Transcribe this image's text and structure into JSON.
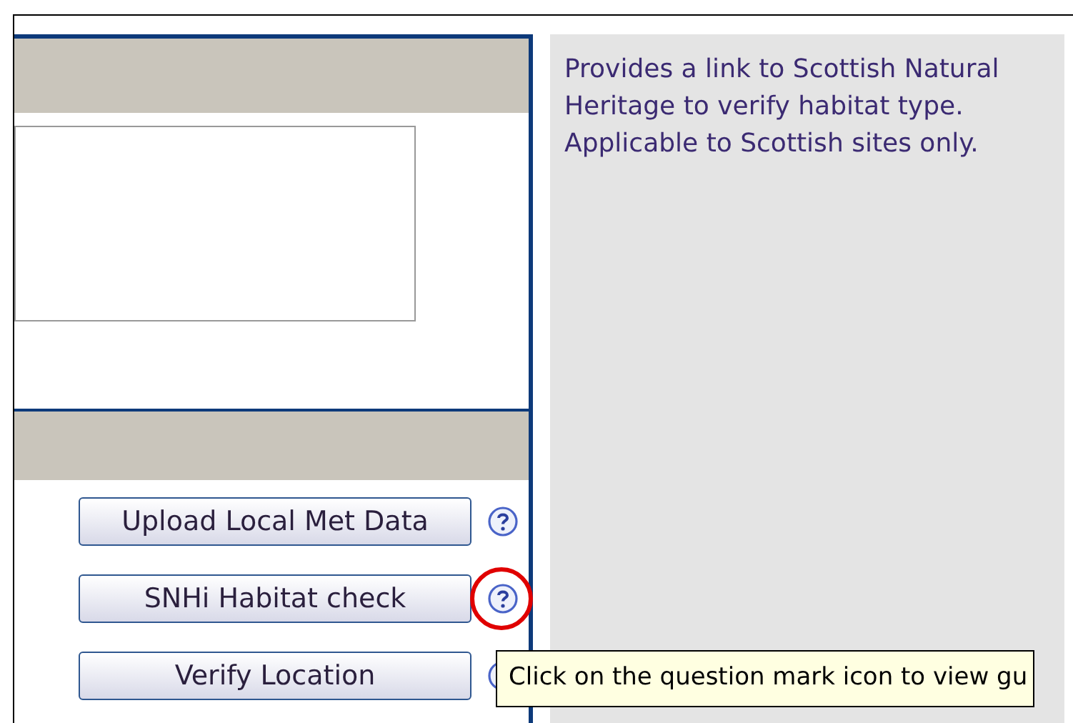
{
  "info_panel": {
    "text": "Provides a link to Scottish Natural Heritage to verify habitat type. Applicable to Scottish sites only."
  },
  "buttons": [
    {
      "label": "Upload Local Met Data",
      "highlighted": false
    },
    {
      "label": "SNHi Habitat check",
      "highlighted": true
    },
    {
      "label": "Verify Location",
      "highlighted": false
    }
  ],
  "tooltip": {
    "text": "Click on the question mark icon to view gu"
  }
}
